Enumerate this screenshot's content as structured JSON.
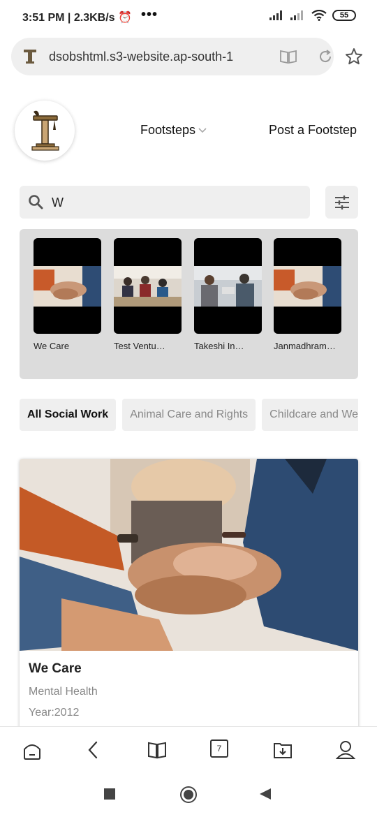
{
  "status_bar": {
    "time": "3:51 PM",
    "speed": "2.3KB/s",
    "battery": "55"
  },
  "browser": {
    "url": "dsobshtml.s3-website.ap-south-1",
    "tab_count": "7"
  },
  "nav": {
    "footsteps": "Footsteps",
    "post": "Post a Footstep"
  },
  "search": {
    "value": "W"
  },
  "suggestions": [
    {
      "label": "We Care",
      "icon": "hands-photo"
    },
    {
      "label": "Test Ventu…",
      "icon": "meeting-photo"
    },
    {
      "label": "Takeshi In…",
      "icon": "office-photo"
    },
    {
      "label": "Janmadhram…",
      "icon": "hands-photo"
    }
  ],
  "categories": [
    {
      "label": "All Social Work",
      "active": true
    },
    {
      "label": "Animal Care and Rights",
      "active": false
    },
    {
      "label": "Childcare and Welfare",
      "active": false
    }
  ],
  "card": {
    "title": "We Care",
    "category": "Mental Health",
    "year": "Year:2012"
  }
}
